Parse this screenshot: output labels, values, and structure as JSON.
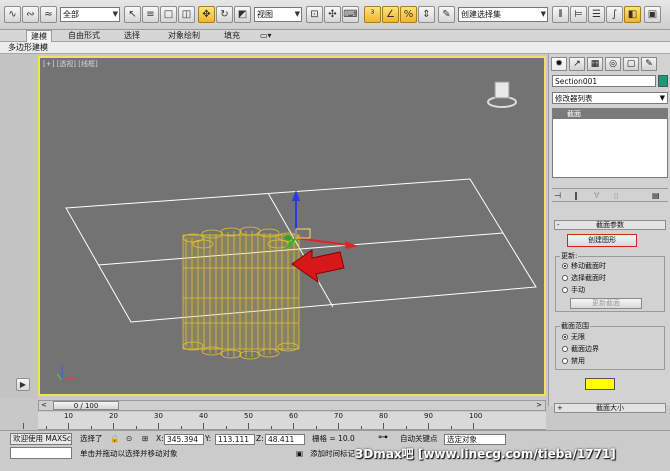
{
  "toolbar": {
    "selection_filter": "全部",
    "reference_coord": "视图",
    "named_selection_placeholder": "创建选择集"
  },
  "ribbon": {
    "tabs": [
      {
        "label": "建模",
        "active": true
      },
      {
        "label": "自由形式",
        "active": false
      },
      {
        "label": "选择",
        "active": false
      },
      {
        "label": "对象绘制",
        "active": false
      },
      {
        "label": "填充",
        "active": false
      }
    ],
    "sub_label": "多边形建模"
  },
  "viewport": {
    "label": "[+] [透视] [线框]",
    "border_color": "#f2e25a",
    "background": "#737373"
  },
  "command_panel": {
    "tab_icons": [
      "sun-icon",
      "curve-icon",
      "hierarchy-icon",
      "motion-icon",
      "display-icon",
      "wrench-icon"
    ],
    "object_name": "Section001",
    "object_color": "#1a9a7a",
    "modifier_list_label": "修改器列表",
    "stack_item": "截面",
    "section_params": {
      "title": "截面参数",
      "create_shape_button": "创建图形",
      "update_group": {
        "title": "更新:",
        "options": [
          {
            "label": "移动截面时",
            "checked": true
          },
          {
            "label": "选择截面时",
            "checked": false
          },
          {
            "label": "手动",
            "checked": false
          }
        ],
        "update_button": "更新截面"
      },
      "extent_group": {
        "title": "截面范围",
        "options": [
          {
            "label": "无限",
            "checked": true
          },
          {
            "label": "截面边界",
            "checked": false
          },
          {
            "label": "禁用",
            "checked": false
          }
        ]
      },
      "swatch_color": "#ffff00"
    },
    "section_size_title": "截面大小"
  },
  "timeline": {
    "frame_label": "0 / 100",
    "ticks": [
      10,
      20,
      30,
      40,
      50,
      60,
      70,
      80,
      90,
      100
    ]
  },
  "status": {
    "script_prompt": "欢迎使用 MAXSc",
    "selection_status": "选择了",
    "x_label": "X:",
    "x_value": "345.394",
    "y_label": "Y:",
    "y_value": "113.111",
    "z_label": "Z:",
    "z_value": "48.411",
    "grid_label": "栅格 = 10.0",
    "auto_key_label": "自动关键点",
    "selected_object": "选定对象",
    "hint_text": "单击并拖动以选择并移动对象",
    "add_time_tag": "添加时间标记"
  },
  "watermark": "3Dmax吧 [www.linecg.com/tieba/1771]"
}
